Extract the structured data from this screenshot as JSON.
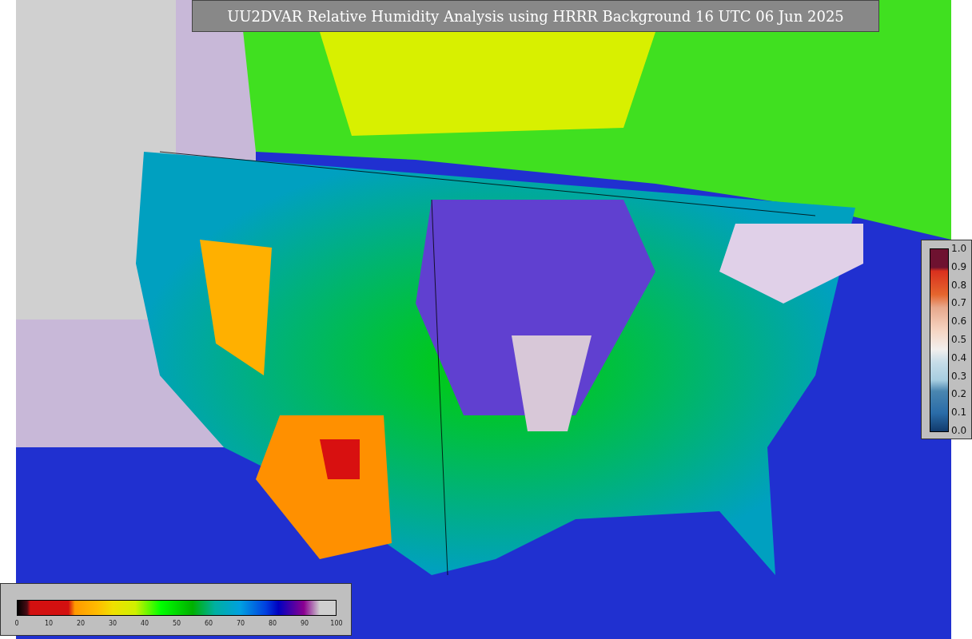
{
  "title": "UU2DVAR Relative Humidity Analysis using HRRR Background 16 UTC 06 Jun 2025",
  "humidity_legend": {
    "ticks": [
      "0",
      "10",
      "20",
      "30",
      "40",
      "50",
      "60",
      "70",
      "80",
      "90",
      "100"
    ]
  },
  "difference_legend": {
    "ticks": [
      "1.0",
      "0.9",
      "0.8",
      "0.7",
      "0.6",
      "0.5",
      "0.4",
      "0.3",
      "0.2",
      "0.1",
      "0.0"
    ]
  }
}
